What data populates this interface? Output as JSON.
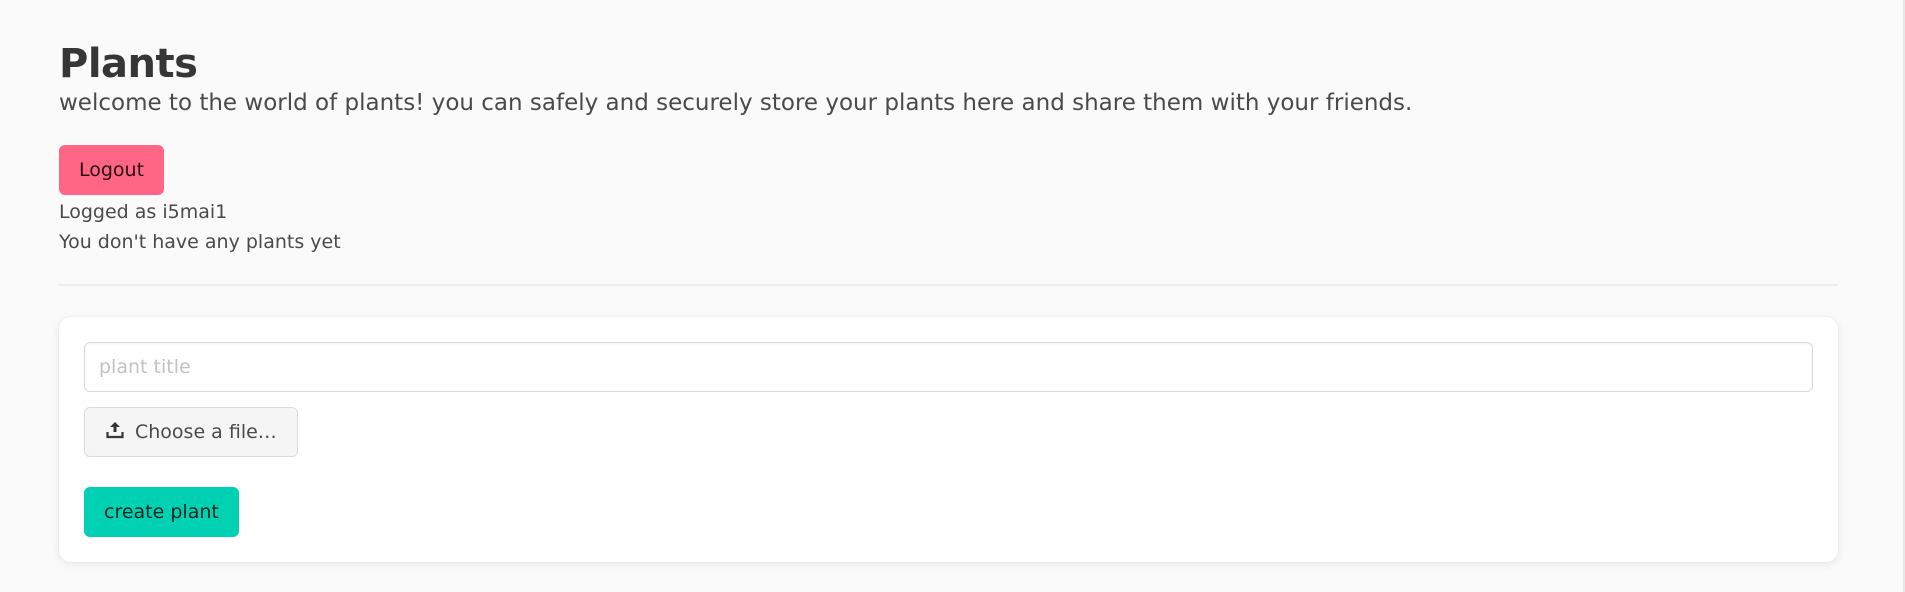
{
  "header": {
    "title": "Plants",
    "subtitle": "welcome to the world of plants! you can safely and securely store your plants here and share them with your friends."
  },
  "account": {
    "logout_label": "Logout",
    "logged_as": "Logged as i5mai1",
    "plants_status": "You don't have any plants yet"
  },
  "form": {
    "title_placeholder": "plant title",
    "title_value": "",
    "file_label": "Choose a file…",
    "file_icon": "upload-icon",
    "submit_label": "create plant"
  },
  "colors": {
    "logout": "#ff6685",
    "submit": "#00d1b2"
  }
}
